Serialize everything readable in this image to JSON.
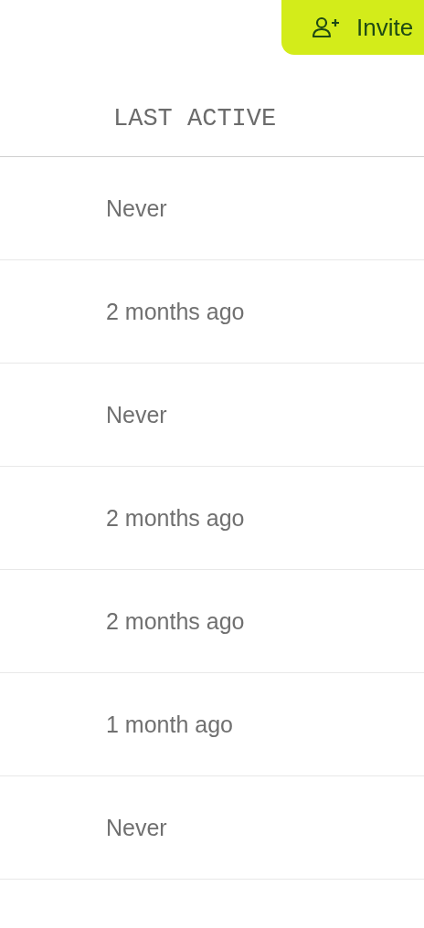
{
  "toolbar": {
    "invite_button": {
      "label": "Invite"
    }
  },
  "table": {
    "columns": [
      "LAST ACTIVE"
    ],
    "rows": [
      {
        "last_active": "Never"
      },
      {
        "last_active": "2 months ago"
      },
      {
        "last_active": "Never"
      },
      {
        "last_active": "2 months ago"
      },
      {
        "last_active": "2 months ago"
      },
      {
        "last_active": "1 month ago"
      },
      {
        "last_active": "Never"
      }
    ]
  }
}
